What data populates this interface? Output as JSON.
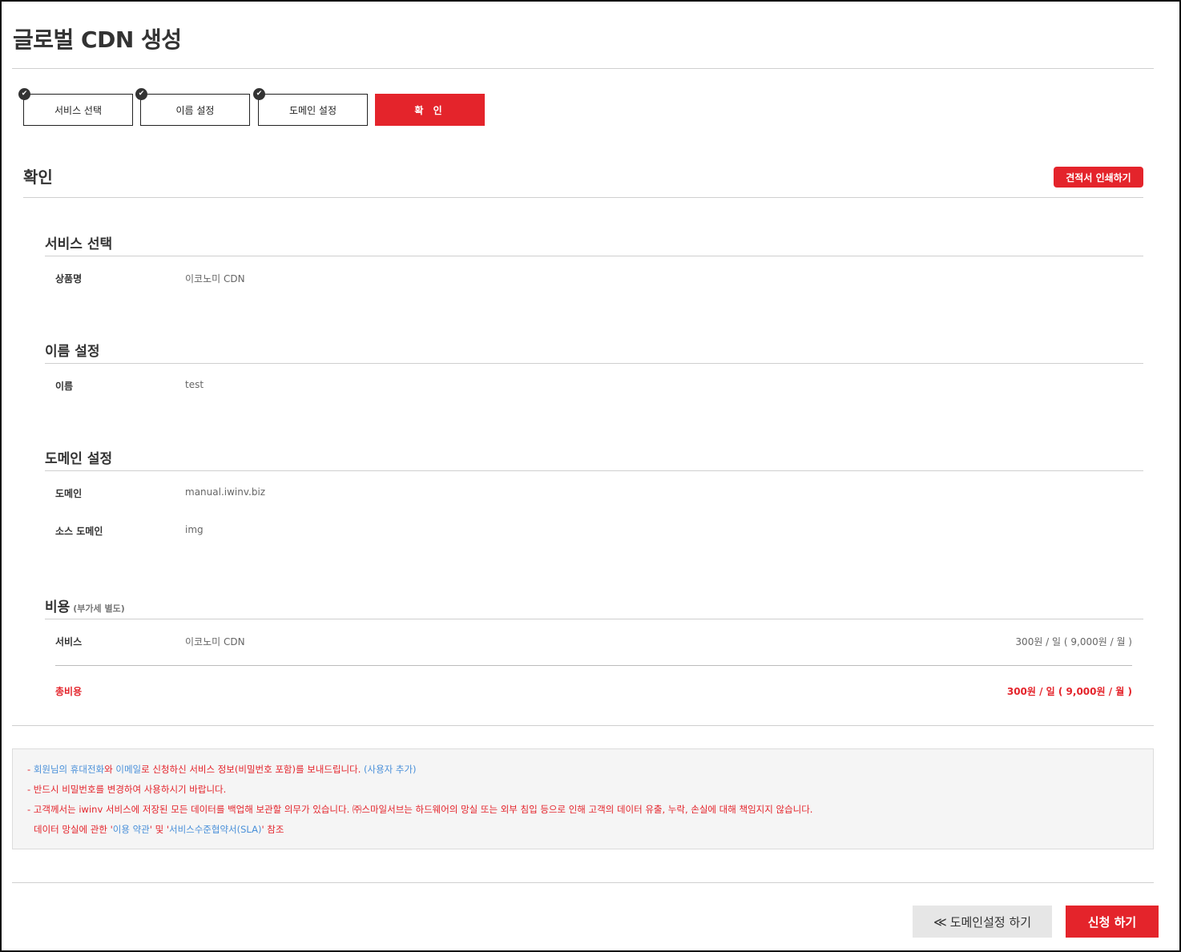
{
  "page": {
    "title": "글로벌 CDN 생성"
  },
  "steps": [
    {
      "label": "서비스 선택",
      "done": true
    },
    {
      "label": "이름 설정",
      "done": true
    },
    {
      "label": "도메인 설정",
      "done": true
    },
    {
      "label": "확 인",
      "active": true
    }
  ],
  "confirm": {
    "title": "확인",
    "print_button": "견적서 인쇄하기"
  },
  "service_section": {
    "title": "서비스 선택",
    "rows": [
      {
        "label": "상품명",
        "value": "이코노미 CDN"
      }
    ]
  },
  "name_section": {
    "title": "이름 설정",
    "rows": [
      {
        "label": "이름",
        "value": "test"
      }
    ]
  },
  "domain_section": {
    "title": "도메인 설정",
    "rows": [
      {
        "label": "도메인",
        "value": "manual.iwinv.biz"
      },
      {
        "label": "소스 도메인",
        "value": "img"
      }
    ]
  },
  "cost_section": {
    "title": "비용",
    "note": "(부가세 별도)",
    "service_row": {
      "label": "서비스",
      "value": "이코노미 CDN",
      "price": "300원 / 일 ( 9,000원 / 월 )"
    },
    "total_row": {
      "label": "총비용",
      "price": "300원 / 일 ( 9,000원 / 월 )"
    }
  },
  "notice": {
    "line1": {
      "prefix": "- ",
      "link1": "회원님의 휴대전화",
      "mid1": "와 ",
      "link2": "이메일",
      "mid2": "로 신청하신 서비스 정보(비밀번호 포함)를 보내드립니다. ",
      "link3": "(사용자 추가)"
    },
    "line2": "- 반드시 비밀번호를 변경하여 사용하시기 바랍니다.",
    "line3": "- 고객께서는 iwinv 서비스에 저장된 모든 데이터를 백업해 보관할 의무가 있습니다. ㈜스마일서브는 하드웨어의 망실 또는 외부 침입 등으로 인해 고객의 데이터 유출, 누락, 손실에 대해 책임지지 않습니다.",
    "line4": {
      "prefix": "데이터 망실에 관한 '",
      "link1": "이용 약관",
      "mid": "' 및 '",
      "link2": "서비스수준협약서(SLA)",
      "suffix": "' 참조"
    }
  },
  "buttons": {
    "prev_arrow": "≪",
    "prev_label": "도메인설정 하기",
    "submit_label": "신청 하기"
  },
  "colors": {
    "accent": "#e4242b",
    "link": "#4a90d9"
  }
}
